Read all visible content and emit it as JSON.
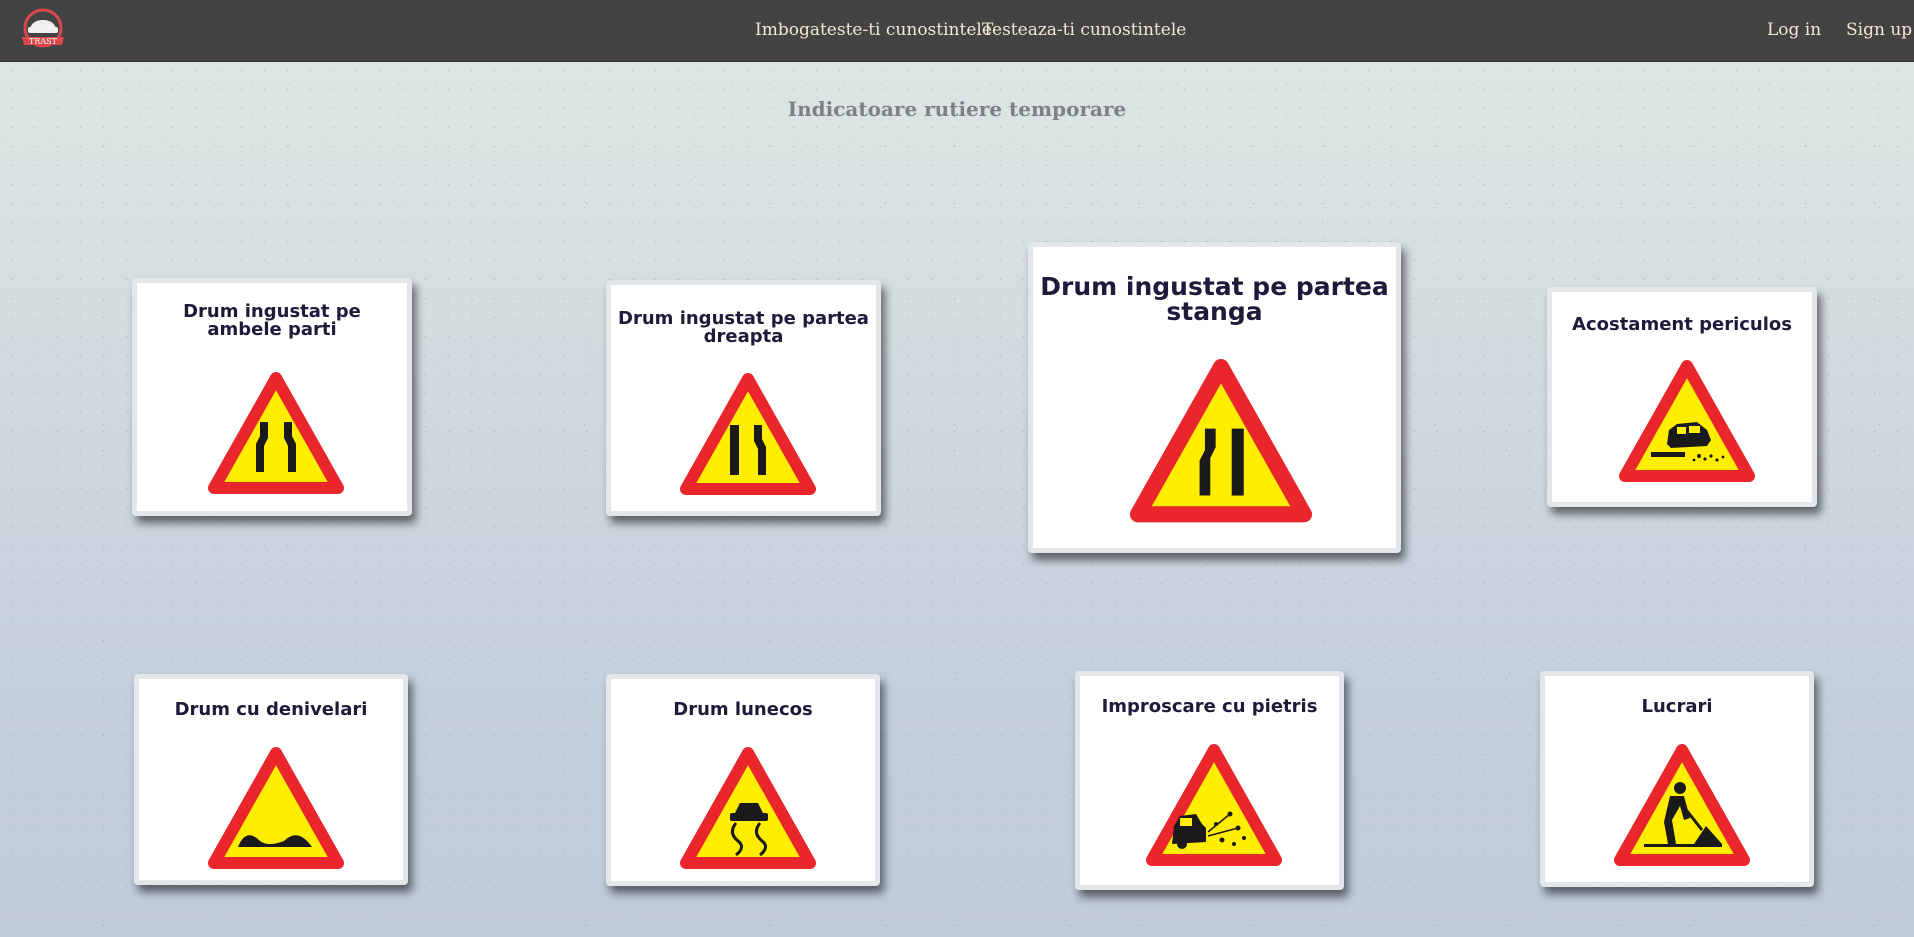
{
  "app": {
    "logo_text": "TRAST",
    "nav": {
      "learn": "Imbogateste-ti cunostintele",
      "test": "Testeaza-ti cunostintele",
      "login": "Log in",
      "signup": "Sign up"
    }
  },
  "page": {
    "title": "Indicatoare rutiere temporare"
  },
  "cards": [
    {
      "title": "Drum ingustat pe ambele parti",
      "icon": "road-narrows-both-sides-icon"
    },
    {
      "title": "Drum ingustat pe partea dreapta",
      "icon": "road-narrows-right-icon"
    },
    {
      "title": "Drum ingustat pe partea stanga",
      "icon": "road-narrows-left-icon"
    },
    {
      "title": "Acostament periculos",
      "icon": "dangerous-shoulder-icon"
    },
    {
      "title": "Drum cu denivelari",
      "icon": "uneven-road-icon"
    },
    {
      "title": "Drum lunecos",
      "icon": "slippery-road-icon"
    },
    {
      "title": "Improscare cu pietris",
      "icon": "loose-gravel-icon"
    },
    {
      "title": "Lucrari",
      "icon": "road-works-icon"
    }
  ],
  "colors": {
    "navbar": "#434343",
    "sign_border": "#e8262b",
    "sign_fill": "#ffee00",
    "card_title": "#1e1b3a"
  }
}
